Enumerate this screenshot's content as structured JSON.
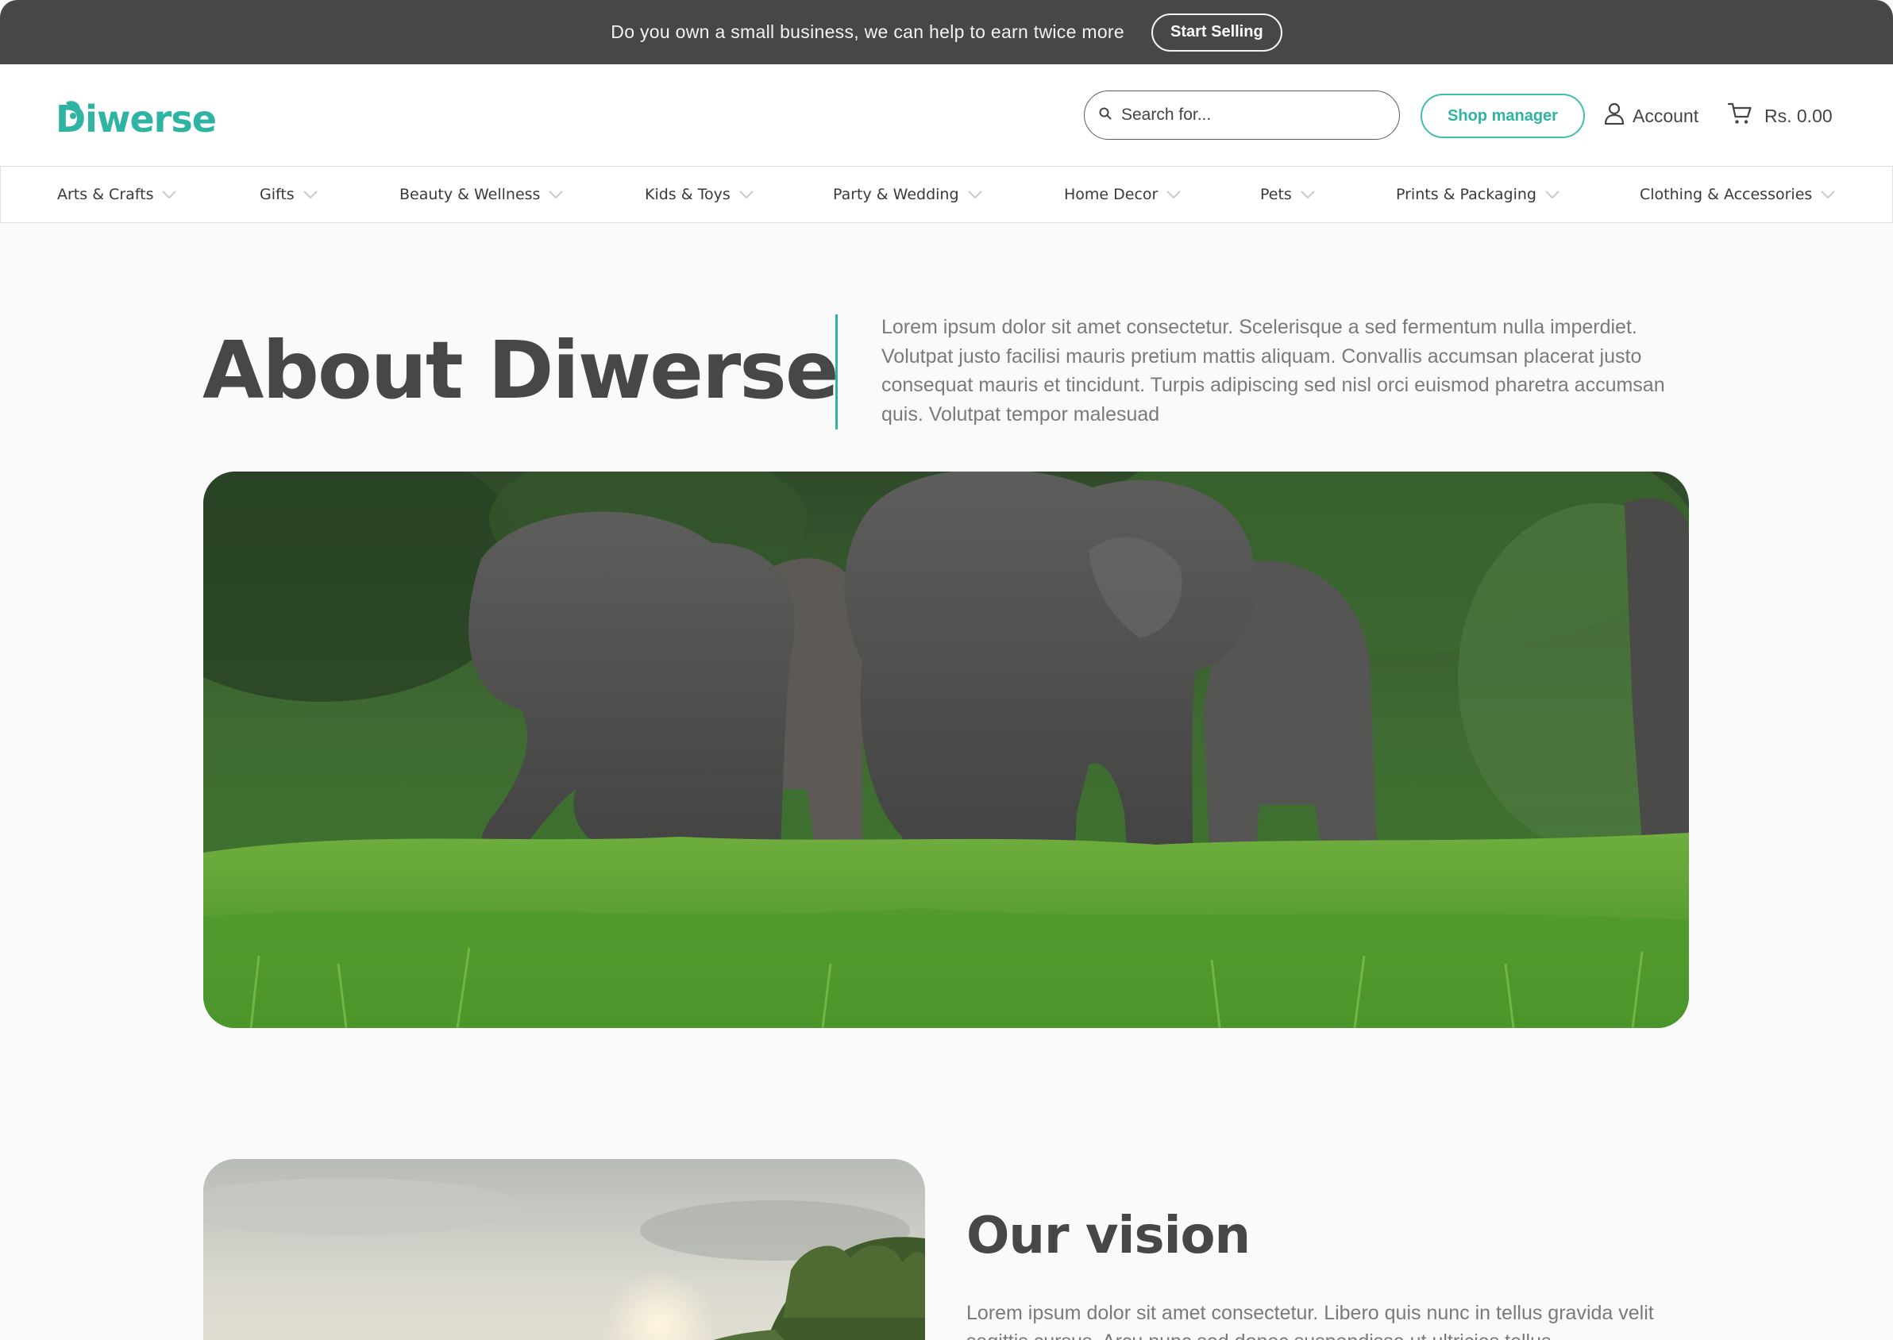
{
  "announcement": {
    "text": "Do you own a small business, we can help to earn twice more",
    "button_label": "Start Selling"
  },
  "header": {
    "logo_text": "Diwerse",
    "search_placeholder": "Search for...",
    "shop_manager_label": "Shop manager",
    "account_label": "Account",
    "cart_total": "Rs. 0.00"
  },
  "categories": [
    "Arts & Crafts",
    "Gifts",
    "Beauty & Wellness",
    "Kids & Toys",
    "Party & Wedding",
    "Home Decor",
    "Pets",
    "Prints & Packaging",
    "Clothing & Accessories"
  ],
  "about": {
    "title": "About Diwerse",
    "text": "Lorem ipsum dolor sit amet consectetur. Scelerisque a sed fermentum nulla imperdiet. Volutpat justo facilisi mauris pretium mattis aliquam. Convallis accumsan placerat justo consequat mauris et tincidunt. Turpis adipiscing sed nisl orci euismod pharetra accumsan quis. Volutpat tempor malesuad"
  },
  "vision": {
    "title": "Our vision",
    "text": "Lorem ipsum dolor sit amet consectetur. Libero quis nunc in tellus gravida velit sagittis cursus. Arcu nunc sed donec suspendisse ut ultricies tellus"
  },
  "colors": {
    "accent": "#2fb3a3",
    "topbar": "#474747",
    "heading": "#474747",
    "body_text": "#7a7a7a",
    "background": "#fafafa"
  },
  "icons": {
    "search": "search-icon",
    "account": "user-icon",
    "cart": "cart-icon",
    "dropdown": "chevron-down-icon"
  }
}
